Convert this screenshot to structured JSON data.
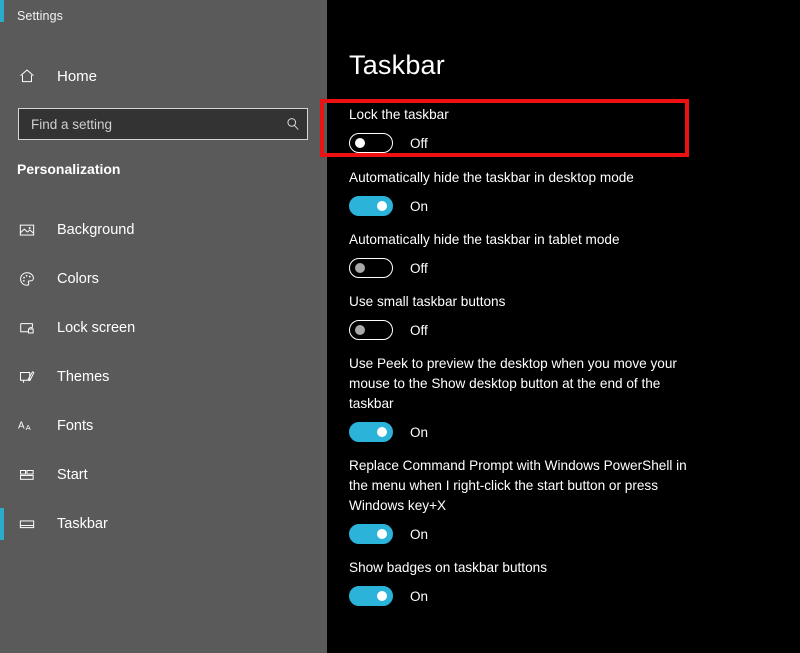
{
  "window": {
    "app_title": "Settings"
  },
  "sidebar": {
    "home": {
      "label": "Home",
      "icon": "home-icon"
    },
    "search": {
      "placeholder": "Find a setting",
      "value": "",
      "icon": "search-icon"
    },
    "section_heading": "Personalization",
    "items": [
      {
        "label": "Background",
        "icon": "picture-icon",
        "selected": false
      },
      {
        "label": "Colors",
        "icon": "palette-icon",
        "selected": false
      },
      {
        "label": "Lock screen",
        "icon": "lock-screen-icon",
        "selected": false
      },
      {
        "label": "Themes",
        "icon": "brush-icon",
        "selected": false
      },
      {
        "label": "Fonts",
        "icon": "fonts-icon",
        "selected": false
      },
      {
        "label": "Start",
        "icon": "start-icon",
        "selected": false
      },
      {
        "label": "Taskbar",
        "icon": "taskbar-icon",
        "selected": true
      }
    ]
  },
  "main": {
    "page_title": "Taskbar",
    "settings": [
      {
        "label": "Lock the taskbar",
        "state": "Off",
        "on": false,
        "highlighted": true
      },
      {
        "label": "Automatically hide the taskbar in desktop mode",
        "state": "On",
        "on": true,
        "highlighted": false
      },
      {
        "label": "Automatically hide the taskbar in tablet mode",
        "state": "Off",
        "on": false,
        "highlighted": false
      },
      {
        "label": "Use small taskbar buttons",
        "state": "Off",
        "on": false,
        "highlighted": false
      },
      {
        "label": "Use Peek to preview the desktop when you move your mouse to the Show desktop button at the end of the taskbar",
        "state": "On",
        "on": true,
        "highlighted": false
      },
      {
        "label": "Replace Command Prompt with Windows PowerShell in the menu when I right-click the start button or press Windows key+X",
        "state": "On",
        "on": true,
        "highlighted": false
      },
      {
        "label": "Show badges on taskbar buttons",
        "state": "On",
        "on": true,
        "highlighted": false
      }
    ]
  },
  "colors": {
    "accent": "#2bb3d9",
    "sidebar_bg": "#5a5a5a",
    "panel_bg": "#000000",
    "annotation": "#ee1111"
  }
}
